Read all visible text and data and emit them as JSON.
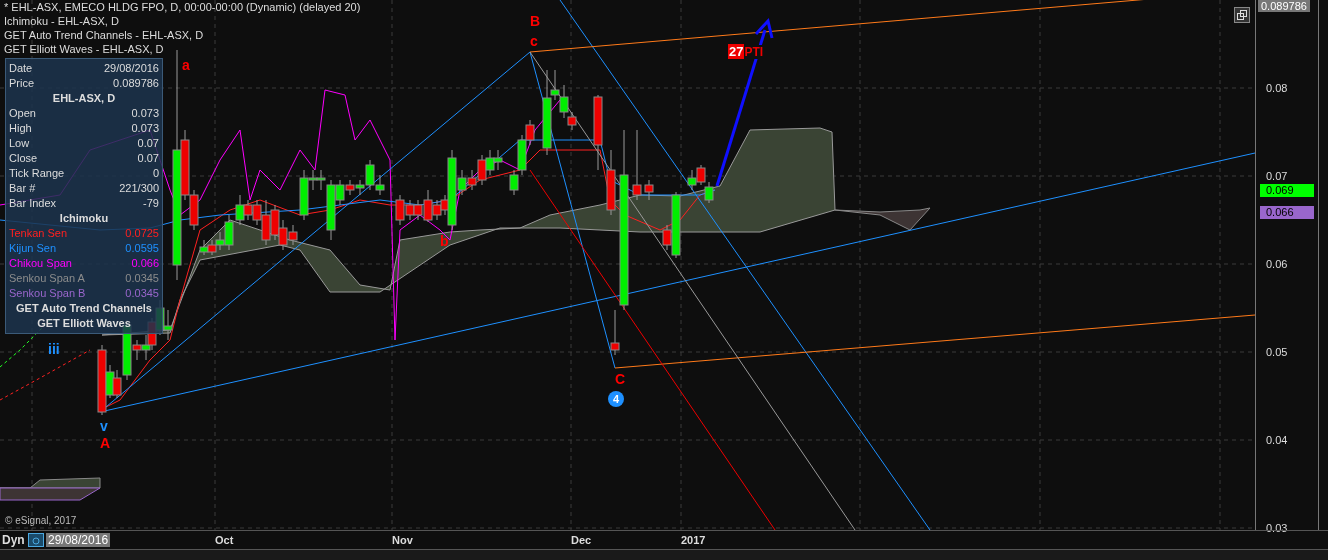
{
  "header_lines": [
    "* EHL-ASX, EMECO HLDG FPO, D, 00:00-00:00 (Dynamic) (delayed 20)",
    "Ichimoku - EHL-ASX, D",
    "GET Auto Trend Channels - EHL-ASX, D",
    "GET Elliott Waves - EHL-ASX, D"
  ],
  "data_window": {
    "top_rows": [
      {
        "label": "Date",
        "value": "29/08/2016"
      },
      {
        "label": "Price",
        "value": "0.089786"
      }
    ],
    "symbol": "EHL-ASX, D",
    "rows": [
      {
        "label": "Open",
        "value": "0.073"
      },
      {
        "label": "High",
        "value": "0.073"
      },
      {
        "label": "Low",
        "value": "0.07"
      },
      {
        "label": "Close",
        "value": "0.07"
      },
      {
        "label": "Tick Range",
        "value": "0"
      },
      {
        "label": "Bar #",
        "value": "221/300"
      },
      {
        "label": "Bar Index",
        "value": "-79"
      }
    ],
    "study_title": "Ichimoku",
    "study_rows": [
      {
        "label": "Tenkan Sen",
        "value": "0.0725",
        "color": "#ff2020"
      },
      {
        "label": "Kijun Sen",
        "value": "0.0595",
        "color": "#1e90ff"
      },
      {
        "label": "Chikou Span",
        "value": "0.066",
        "color": "#ff00ff"
      },
      {
        "label": "Senkou Span A",
        "value": "0.0345",
        "color": "#8c8c8c"
      },
      {
        "label": "Senkou Span B",
        "value": "0.0345",
        "color": "#9966cc"
      }
    ],
    "footer": [
      "GET Auto Trend Channels",
      "GET Elliott Waves"
    ]
  },
  "wave_labels": [
    {
      "text": "B",
      "color": "#ff0000"
    },
    {
      "text": "c",
      "color": "#ff0000"
    },
    {
      "text": "a",
      "color": "#ff0000"
    },
    {
      "text": "b",
      "color": "#ff0000"
    },
    {
      "text": "C",
      "color": "#ff0000"
    },
    {
      "text": "iii",
      "color": "#1e90ff"
    },
    {
      "text": "v",
      "color": "#1e90ff"
    },
    {
      "text": "A",
      "color": "#ff0000"
    }
  ],
  "wave_count": "4",
  "target": {
    "badge": "27",
    "text": "PTI"
  },
  "copyright": "© eSignal, 2017",
  "price_axis": {
    "last_price": "0.089786",
    "ticks": [
      "0.08",
      "0.07",
      "0.06",
      "0.05",
      "0.04",
      "0.03"
    ],
    "markers": [
      {
        "text": "0.069",
        "color": "#00ff00"
      },
      {
        "text": "0.066",
        "color": "#9966cc"
      }
    ]
  },
  "time_axis": {
    "button": "Dyn",
    "date": "29/08/2016",
    "labels": [
      "Oct",
      "Nov",
      "Dec",
      "2017"
    ]
  }
}
